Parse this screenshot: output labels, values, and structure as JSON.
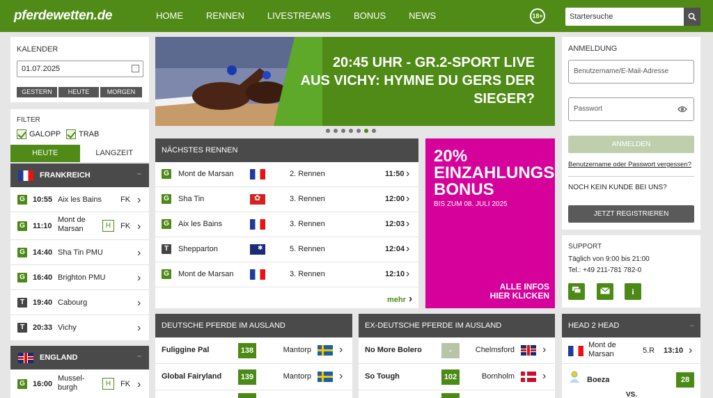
{
  "header": {
    "logo": "pferdewetten.de",
    "nav": [
      "HOME",
      "RENNEN",
      "LIVESTREAMS",
      "BONUS",
      "NEWS"
    ],
    "age_badge": "18+",
    "search_placeholder": "Startersuche"
  },
  "calendar": {
    "label": "KALENDER",
    "date": "01.07.2025",
    "buttons": [
      "GESTERN",
      "HEUTE",
      "MORGEN"
    ]
  },
  "filter": {
    "label": "FILTER",
    "options": [
      "GALOPP",
      "TRAB"
    ],
    "tabs": [
      "HEUTE",
      "LANGZEIT"
    ]
  },
  "countries": [
    {
      "name": "FRANKREICH",
      "flag": "fr",
      "races": [
        {
          "type": "G",
          "time": "10:55",
          "venue": "Aix les Bains",
          "h": "",
          "kind": "FK"
        },
        {
          "type": "G",
          "time": "11:10",
          "venue": "Mont de Marsan",
          "h": "H",
          "kind": "FK"
        },
        {
          "type": "G",
          "time": "14:40",
          "venue": "Sha Tin PMU",
          "h": "",
          "kind": ""
        },
        {
          "type": "G",
          "time": "16:40",
          "venue": "Brighton PMU",
          "h": "",
          "kind": ""
        },
        {
          "type": "T",
          "time": "19:40",
          "venue": "Cabourg",
          "h": "",
          "kind": ""
        },
        {
          "type": "T",
          "time": "20:33",
          "venue": "Vichy",
          "h": "",
          "kind": ""
        }
      ]
    },
    {
      "name": "ENGLAND",
      "flag": "uk",
      "races": [
        {
          "type": "G",
          "time": "16:00",
          "venue": "Mussel-burgh",
          "h": "H",
          "kind": "FK"
        }
      ]
    }
  ],
  "banner": {
    "text": "20:45 UHR - GR.2-SPORT LIVE AUS VICHY: HYMNE DU GERS DER SIEGER?",
    "line1": "20:45 UHR - GR.2-SPORT LIVE",
    "line2": "AUS VICHY: HYMNE DU GERS DER",
    "line3": "SIEGER?",
    "dot_count": 7,
    "active_dot": 6
  },
  "next_races": {
    "title": "NÄCHSTES RENNEN",
    "more": "mehr",
    "rows": [
      {
        "type": "G",
        "venue": "Mont de Marsan",
        "flag": "fr",
        "race": "2. Rennen",
        "time": "11:50"
      },
      {
        "type": "G",
        "venue": "Sha Tin",
        "flag": "hk",
        "race": "3. Rennen",
        "time": "12:00"
      },
      {
        "type": "G",
        "venue": "Aix les Bains",
        "flag": "fr",
        "race": "3. Rennen",
        "time": "12:03"
      },
      {
        "type": "T",
        "venue": "Shepparton",
        "flag": "au",
        "race": "5. Rennen",
        "time": "12:04"
      },
      {
        "type": "G",
        "venue": "Mont de Marsan",
        "flag": "fr",
        "race": "3. Rennen",
        "time": "12:10"
      }
    ]
  },
  "promo": {
    "percent": "20%",
    "line1": "EINZAHLUNGS",
    "line2": "BONUS",
    "until": "BIS ZUM 08. JULI 2025",
    "cta1": "ALLE INFOS",
    "cta2": "HIER KLICKEN",
    "color": "#d6009a"
  },
  "german_abroad": {
    "title": "DEUTSCHE PFERDE IM AUSLAND",
    "rows": [
      {
        "horse": "Fuliggine Pal",
        "num": "138",
        "place": "Mantorp",
        "flag": "se"
      },
      {
        "horse": "Global Fairyland",
        "num": "139",
        "place": "Mantorp",
        "flag": "se"
      }
    ]
  },
  "ex_german_abroad": {
    "title": "EX-DEUTSCHE PFERDE IM AUSLAND",
    "rows": [
      {
        "horse": "No More Bolero",
        "num": "-",
        "place": "Chelmsford",
        "flag": "uk"
      },
      {
        "horse": "So Tough",
        "num": "102",
        "place": "Bornholm",
        "flag": "dk"
      }
    ]
  },
  "login": {
    "label": "ANMELDUNG",
    "user_placeholder": "Benutzername/E-Mail-Adresse",
    "pass_placeholder": "Passwort",
    "login_btn": "ANMELDEN",
    "forgot": "Benutzername oder Passwort vergessen?",
    "no_customer": "NOCH KEIN KUNDE BEI UNS?",
    "register_btn": "JETZT REGISTRIEREN"
  },
  "support": {
    "label": "SUPPORT",
    "hours": "Täglich von 9:00 bis 21:00",
    "phone": "Tel.: +49 211-781 782-0"
  },
  "h2h": {
    "title": "HEAD 2 HEAD",
    "venue": "Mont de Marsan",
    "race": "5.R",
    "time": "13:10",
    "horse": "Boeza",
    "num": "28",
    "vs": "VS."
  },
  "colors": {
    "brand_green": "#4f8b16",
    "dark": "#4a4a4a",
    "promo": "#d6009a"
  }
}
